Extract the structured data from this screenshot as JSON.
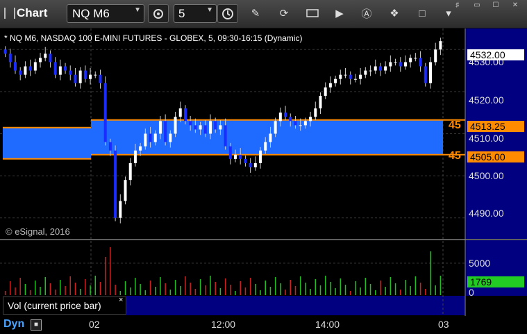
{
  "window": {
    "title": "Chart"
  },
  "toolbar": {
    "symbol": "NQ M6",
    "interval": "5"
  },
  "chart": {
    "title": "* NQ M6, NASDAQ 100 E-MINI FUTURES - GLOBEX, 5, 09:30-16:15 (Dynamic)",
    "copyright": "© eSignal, 2016",
    "y_ticks": [
      "4530.00",
      "4520.00",
      "4510.00",
      "4500.00",
      "4490.00"
    ],
    "current_price": "4532.00",
    "levels": [
      {
        "label": "45",
        "price": "4513.25"
      },
      {
        "label": "45",
        "price": "4505.00"
      }
    ],
    "x_ticks": [
      "02",
      "12:00",
      "14:00",
      "03"
    ]
  },
  "volume": {
    "legend": "Vol (current price bar)",
    "close": "×",
    "y_ticks": [
      "5000",
      "0"
    ],
    "current": "1769"
  },
  "footer": {
    "mode": "Dyn"
  },
  "colors": {
    "zone": "#1f6bff",
    "level": "#ff8c00",
    "up": "#ffffff",
    "down": "#1a2cff",
    "vol_up": "#22c022",
    "vol_down": "#d02020",
    "price_box": "#ffffff",
    "vol_box": "#22cc22",
    "panel": "#000080"
  },
  "chart_data": {
    "type": "candlestick",
    "title": "* NQ M6, NASDAQ 100 E-MINI FUTURES - GLOBEX, 5, 09:30-16:15 (Dynamic)",
    "ylim": [
      4485,
      4535
    ],
    "y_ticks": [
      4490,
      4500,
      4510,
      4520,
      4530
    ],
    "x_ticks": [
      "02",
      "12:00",
      "14:00",
      "03"
    ],
    "zone": {
      "high": 4513.25,
      "low": 4505.0
    },
    "last": 4532.0,
    "closes": [
      4529,
      4527,
      4525,
      4524,
      4526,
      4525,
      4527,
      4528,
      4529,
      4527,
      4524,
      4526,
      4525,
      4524,
      4522,
      4525,
      4523,
      4524,
      4524,
      4522,
      4508,
      4506,
      4490,
      4494,
      4499,
      4503,
      4506,
      4507,
      4510,
      4508,
      4510,
      4513,
      4508,
      4510,
      4514,
      4516,
      4513,
      4512,
      4511,
      4512,
      4510,
      4513,
      4511,
      4512,
      4507,
      4504,
      4505,
      4504,
      4503,
      4502,
      4503,
      4506,
      4508,
      4510,
      4513,
      4515,
      4514,
      4513,
      4512,
      4512,
      4513,
      4514,
      4516,
      4519,
      4521,
      4522,
      4523,
      4524,
      4524,
      4523,
      4523,
      4524,
      4525,
      4525,
      4526,
      4525,
      4526,
      4527,
      4527,
      4526,
      4527,
      4528,
      4528,
      4526,
      4522,
      4527,
      4530,
      4532
    ],
    "volume_max": 6000
  }
}
